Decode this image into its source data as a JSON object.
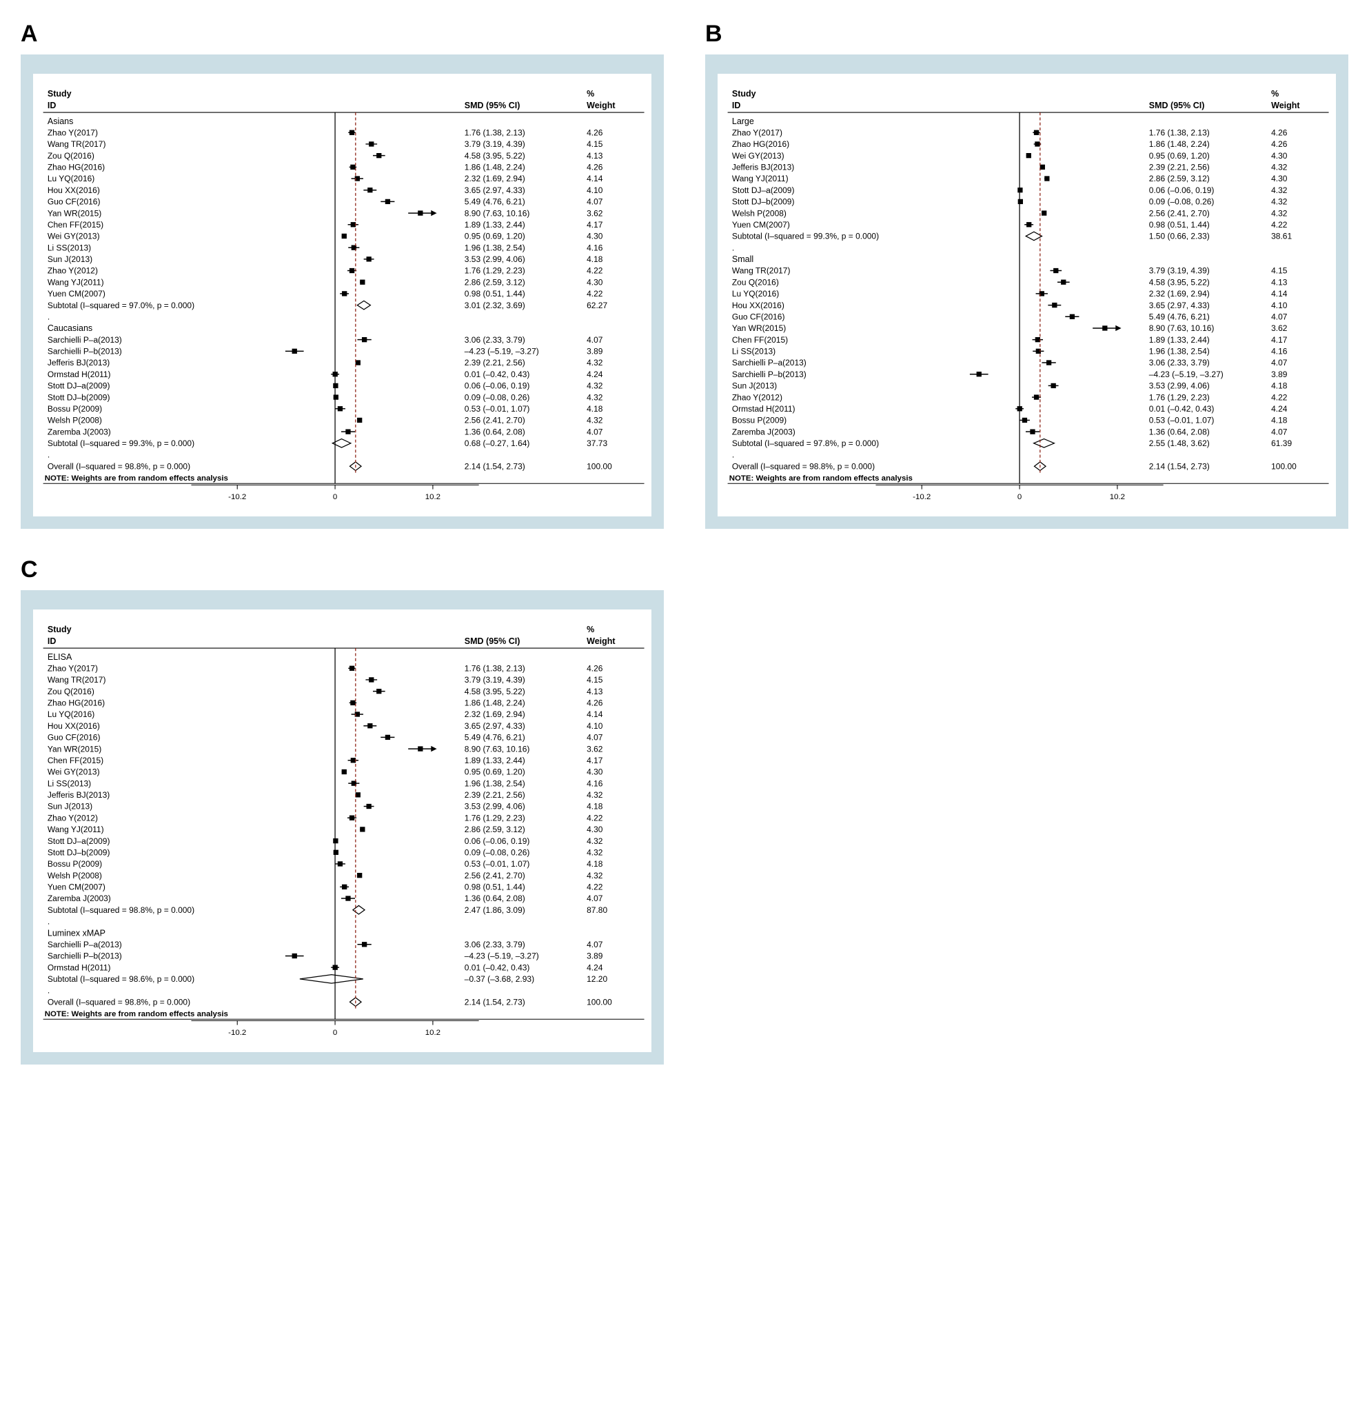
{
  "chart_data": [
    {
      "id": "A",
      "type": "forestplot",
      "title": "",
      "headers": {
        "study": "Study",
        "id": "ID",
        "smd": "SMD (95% CI)",
        "pct": "%",
        "weight": "Weight"
      },
      "xlim": [
        -12,
        12
      ],
      "xticks": [
        -10.2,
        0,
        10.2
      ],
      "overall_line": 2.14,
      "groups": [
        {
          "name": "Asians",
          "rows": [
            {
              "label": "Zhao Y(2017)",
              "pt": 1.76,
              "lo": 1.38,
              "hi": 2.13,
              "smd": "1.76 (1.38, 2.13)",
              "weight": "4.26"
            },
            {
              "label": "Wang TR(2017)",
              "pt": 3.79,
              "lo": 3.19,
              "hi": 4.39,
              "smd": "3.79 (3.19, 4.39)",
              "weight": "4.15"
            },
            {
              "label": "Zou Q(2016)",
              "pt": 4.58,
              "lo": 3.95,
              "hi": 5.22,
              "smd": "4.58 (3.95, 5.22)",
              "weight": "4.13"
            },
            {
              "label": "Zhao HG(2016)",
              "pt": 1.86,
              "lo": 1.48,
              "hi": 2.24,
              "smd": "1.86 (1.48, 2.24)",
              "weight": "4.26"
            },
            {
              "label": "Lu YQ(2016)",
              "pt": 2.32,
              "lo": 1.69,
              "hi": 2.94,
              "smd": "2.32 (1.69, 2.94)",
              "weight": "4.14"
            },
            {
              "label": "Hou XX(2016)",
              "pt": 3.65,
              "lo": 2.97,
              "hi": 4.33,
              "smd": "3.65 (2.97, 4.33)",
              "weight": "4.10"
            },
            {
              "label": "Guo CF(2016)",
              "pt": 5.49,
              "lo": 4.76,
              "hi": 6.21,
              "smd": "5.49 (4.76, 6.21)",
              "weight": "4.07"
            },
            {
              "label": "Yan WR(2015)",
              "pt": 8.9,
              "lo": 7.63,
              "hi": 10.16,
              "smd": "8.90 (7.63, 10.16)",
              "weight": "3.62",
              "arrow": true
            },
            {
              "label": "Chen FF(2015)",
              "pt": 1.89,
              "lo": 1.33,
              "hi": 2.44,
              "smd": "1.89 (1.33, 2.44)",
              "weight": "4.17"
            },
            {
              "label": "Wei GY(2013)",
              "pt": 0.95,
              "lo": 0.69,
              "hi": 1.2,
              "smd": "0.95 (0.69, 1.20)",
              "weight": "4.30"
            },
            {
              "label": "Li SS(2013)",
              "pt": 1.96,
              "lo": 1.38,
              "hi": 2.54,
              "smd": "1.96 (1.38, 2.54)",
              "weight": "4.16"
            },
            {
              "label": "Sun J(2013)",
              "pt": 3.53,
              "lo": 2.99,
              "hi": 4.06,
              "smd": "3.53 (2.99, 4.06)",
              "weight": "4.18"
            },
            {
              "label": "Zhao Y(2012)",
              "pt": 1.76,
              "lo": 1.29,
              "hi": 2.23,
              "smd": "1.76 (1.29, 2.23)",
              "weight": "4.22"
            },
            {
              "label": "Wang YJ(2011)",
              "pt": 2.86,
              "lo": 2.59,
              "hi": 3.12,
              "smd": "2.86 (2.59, 3.12)",
              "weight": "4.30"
            },
            {
              "label": "Yuen CM(2007)",
              "pt": 0.98,
              "lo": 0.51,
              "hi": 1.44,
              "smd": "0.98 (0.51, 1.44)",
              "weight": "4.22"
            }
          ],
          "subtotal": {
            "label": "Subtotal  (I–squared = 97.0%, p = 0.000)",
            "pt": 3.01,
            "lo": 2.32,
            "hi": 3.69,
            "smd": "3.01 (2.32, 3.69)",
            "weight": "62.27"
          }
        },
        {
          "name": "Caucasians",
          "rows": [
            {
              "label": "Sarchielli P–a(2013)",
              "pt": 3.06,
              "lo": 2.33,
              "hi": 3.79,
              "smd": "3.06 (2.33, 3.79)",
              "weight": "4.07"
            },
            {
              "label": "Sarchielli P–b(2013)",
              "pt": -4.23,
              "lo": -5.19,
              "hi": -3.27,
              "smd": "–4.23 (–5.19, –3.27)",
              "weight": "3.89"
            },
            {
              "label": "Jefferis BJ(2013)",
              "pt": 2.39,
              "lo": 2.21,
              "hi": 2.56,
              "smd": "2.39 (2.21, 2.56)",
              "weight": "4.32"
            },
            {
              "label": "Ormstad H(2011)",
              "pt": 0.01,
              "lo": -0.42,
              "hi": 0.43,
              "smd": "0.01 (–0.42, 0.43)",
              "weight": "4.24"
            },
            {
              "label": "Stott DJ–a(2009)",
              "pt": 0.06,
              "lo": -0.06,
              "hi": 0.19,
              "smd": "0.06 (–0.06, 0.19)",
              "weight": "4.32"
            },
            {
              "label": "Stott DJ–b(2009)",
              "pt": 0.09,
              "lo": -0.08,
              "hi": 0.26,
              "smd": "0.09 (–0.08, 0.26)",
              "weight": "4.32"
            },
            {
              "label": "Bossu P(2009)",
              "pt": 0.53,
              "lo": -0.01,
              "hi": 1.07,
              "smd": "0.53 (–0.01, 1.07)",
              "weight": "4.18"
            },
            {
              "label": "Welsh P(2008)",
              "pt": 2.56,
              "lo": 2.41,
              "hi": 2.7,
              "smd": "2.56 (2.41, 2.70)",
              "weight": "4.32"
            },
            {
              "label": "Zaremba J(2003)",
              "pt": 1.36,
              "lo": 0.64,
              "hi": 2.08,
              "smd": "1.36 (0.64, 2.08)",
              "weight": "4.07"
            }
          ],
          "subtotal": {
            "label": "Subtotal  (I–squared = 99.3%, p = 0.000)",
            "pt": 0.68,
            "lo": -0.27,
            "hi": 1.64,
            "smd": "0.68 (–0.27, 1.64)",
            "weight": "37.73"
          }
        }
      ],
      "overall": {
        "label": "Overall  (I–squared = 98.8%, p = 0.000)",
        "pt": 2.14,
        "lo": 1.54,
        "hi": 2.73,
        "smd": "2.14 (1.54, 2.73)",
        "weight": "100.00"
      },
      "note": "NOTE: Weights are from random effects analysis"
    },
    {
      "id": "B",
      "type": "forestplot",
      "headers": {
        "study": "Study",
        "id": "ID",
        "smd": "SMD (95% CI)",
        "pct": "%",
        "weight": "Weight"
      },
      "xlim": [
        -12,
        12
      ],
      "xticks": [
        -10.2,
        0,
        10.2
      ],
      "overall_line": 2.14,
      "groups": [
        {
          "name": "Large",
          "rows": [
            {
              "label": "Zhao Y(2017)",
              "pt": 1.76,
              "lo": 1.38,
              "hi": 2.13,
              "smd": "1.76 (1.38, 2.13)",
              "weight": "4.26"
            },
            {
              "label": "Zhao HG(2016)",
              "pt": 1.86,
              "lo": 1.48,
              "hi": 2.24,
              "smd": "1.86 (1.48, 2.24)",
              "weight": "4.26"
            },
            {
              "label": "Wei GY(2013)",
              "pt": 0.95,
              "lo": 0.69,
              "hi": 1.2,
              "smd": "0.95 (0.69, 1.20)",
              "weight": "4.30"
            },
            {
              "label": "Jefferis BJ(2013)",
              "pt": 2.39,
              "lo": 2.21,
              "hi": 2.56,
              "smd": "2.39 (2.21, 2.56)",
              "weight": "4.32"
            },
            {
              "label": "Wang YJ(2011)",
              "pt": 2.86,
              "lo": 2.59,
              "hi": 3.12,
              "smd": "2.86 (2.59, 3.12)",
              "weight": "4.30"
            },
            {
              "label": "Stott DJ–a(2009)",
              "pt": 0.06,
              "lo": -0.06,
              "hi": 0.19,
              "smd": "0.06 (–0.06, 0.19)",
              "weight": "4.32"
            },
            {
              "label": "Stott DJ–b(2009)",
              "pt": 0.09,
              "lo": -0.08,
              "hi": 0.26,
              "smd": "0.09 (–0.08, 0.26)",
              "weight": "4.32"
            },
            {
              "label": "Welsh P(2008)",
              "pt": 2.56,
              "lo": 2.41,
              "hi": 2.7,
              "smd": "2.56 (2.41, 2.70)",
              "weight": "4.32"
            },
            {
              "label": "Yuen CM(2007)",
              "pt": 0.98,
              "lo": 0.51,
              "hi": 1.44,
              "smd": "0.98 (0.51, 1.44)",
              "weight": "4.22"
            }
          ],
          "subtotal": {
            "label": "Subtotal  (I–squared = 99.3%, p = 0.000)",
            "pt": 1.5,
            "lo": 0.66,
            "hi": 2.33,
            "smd": "1.50 (0.66, 2.33)",
            "weight": "38.61"
          }
        },
        {
          "name": "Small",
          "rows": [
            {
              "label": "Wang TR(2017)",
              "pt": 3.79,
              "lo": 3.19,
              "hi": 4.39,
              "smd": "3.79 (3.19, 4.39)",
              "weight": "4.15"
            },
            {
              "label": "Zou Q(2016)",
              "pt": 4.58,
              "lo": 3.95,
              "hi": 5.22,
              "smd": "4.58 (3.95, 5.22)",
              "weight": "4.13"
            },
            {
              "label": "Lu YQ(2016)",
              "pt": 2.32,
              "lo": 1.69,
              "hi": 2.94,
              "smd": "2.32 (1.69, 2.94)",
              "weight": "4.14"
            },
            {
              "label": "Hou XX(2016)",
              "pt": 3.65,
              "lo": 2.97,
              "hi": 4.33,
              "smd": "3.65 (2.97, 4.33)",
              "weight": "4.10"
            },
            {
              "label": "Guo CF(2016)",
              "pt": 5.49,
              "lo": 4.76,
              "hi": 6.21,
              "smd": "5.49 (4.76, 6.21)",
              "weight": "4.07"
            },
            {
              "label": "Yan WR(2015)",
              "pt": 8.9,
              "lo": 7.63,
              "hi": 10.16,
              "smd": "8.90 (7.63, 10.16)",
              "weight": "3.62",
              "arrow": true
            },
            {
              "label": "Chen FF(2015)",
              "pt": 1.89,
              "lo": 1.33,
              "hi": 2.44,
              "smd": "1.89 (1.33, 2.44)",
              "weight": "4.17"
            },
            {
              "label": "Li SS(2013)",
              "pt": 1.96,
              "lo": 1.38,
              "hi": 2.54,
              "smd": "1.96 (1.38, 2.54)",
              "weight": "4.16"
            },
            {
              "label": "Sarchielli P–a(2013)",
              "pt": 3.06,
              "lo": 2.33,
              "hi": 3.79,
              "smd": "3.06 (2.33, 3.79)",
              "weight": "4.07"
            },
            {
              "label": "Sarchielli P–b(2013)",
              "pt": -4.23,
              "lo": -5.19,
              "hi": -3.27,
              "smd": "–4.23 (–5.19, –3.27)",
              "weight": "3.89"
            },
            {
              "label": "Sun J(2013)",
              "pt": 3.53,
              "lo": 2.99,
              "hi": 4.06,
              "smd": "3.53 (2.99, 4.06)",
              "weight": "4.18"
            },
            {
              "label": "Zhao Y(2012)",
              "pt": 1.76,
              "lo": 1.29,
              "hi": 2.23,
              "smd": "1.76 (1.29, 2.23)",
              "weight": "4.22"
            },
            {
              "label": "Ormstad H(2011)",
              "pt": 0.01,
              "lo": -0.42,
              "hi": 0.43,
              "smd": "0.01 (–0.42, 0.43)",
              "weight": "4.24"
            },
            {
              "label": "Bossu P(2009)",
              "pt": 0.53,
              "lo": -0.01,
              "hi": 1.07,
              "smd": "0.53 (–0.01, 1.07)",
              "weight": "4.18"
            },
            {
              "label": "Zaremba J(2003)",
              "pt": 1.36,
              "lo": 0.64,
              "hi": 2.08,
              "smd": "1.36 (0.64, 2.08)",
              "weight": "4.07"
            }
          ],
          "subtotal": {
            "label": "Subtotal  (I–squared = 97.8%, p = 0.000)",
            "pt": 2.55,
            "lo": 1.48,
            "hi": 3.62,
            "smd": "2.55 (1.48, 3.62)",
            "weight": "61.39"
          }
        }
      ],
      "overall": {
        "label": "Overall  (I–squared = 98.8%, p = 0.000)",
        "pt": 2.14,
        "lo": 1.54,
        "hi": 2.73,
        "smd": "2.14 (1.54, 2.73)",
        "weight": "100.00"
      },
      "note": "NOTE: Weights are from random effects analysis"
    },
    {
      "id": "C",
      "type": "forestplot",
      "headers": {
        "study": "Study",
        "id": "ID",
        "smd": "SMD (95% CI)",
        "pct": "%",
        "weight": "Weight"
      },
      "xlim": [
        -12,
        12
      ],
      "xticks": [
        -10.2,
        0,
        10.2
      ],
      "overall_line": 2.14,
      "groups": [
        {
          "name": "ELISA",
          "rows": [
            {
              "label": "Zhao Y(2017)",
              "pt": 1.76,
              "lo": 1.38,
              "hi": 2.13,
              "smd": "1.76 (1.38, 2.13)",
              "weight": "4.26"
            },
            {
              "label": "Wang TR(2017)",
              "pt": 3.79,
              "lo": 3.19,
              "hi": 4.39,
              "smd": "3.79 (3.19, 4.39)",
              "weight": "4.15"
            },
            {
              "label": "Zou Q(2016)",
              "pt": 4.58,
              "lo": 3.95,
              "hi": 5.22,
              "smd": "4.58 (3.95, 5.22)",
              "weight": "4.13"
            },
            {
              "label": "Zhao HG(2016)",
              "pt": 1.86,
              "lo": 1.48,
              "hi": 2.24,
              "smd": "1.86 (1.48, 2.24)",
              "weight": "4.26"
            },
            {
              "label": "Lu YQ(2016)",
              "pt": 2.32,
              "lo": 1.69,
              "hi": 2.94,
              "smd": "2.32 (1.69, 2.94)",
              "weight": "4.14"
            },
            {
              "label": "Hou XX(2016)",
              "pt": 3.65,
              "lo": 2.97,
              "hi": 4.33,
              "smd": "3.65 (2.97, 4.33)",
              "weight": "4.10"
            },
            {
              "label": "Guo CF(2016)",
              "pt": 5.49,
              "lo": 4.76,
              "hi": 6.21,
              "smd": "5.49 (4.76, 6.21)",
              "weight": "4.07"
            },
            {
              "label": "Yan WR(2015)",
              "pt": 8.9,
              "lo": 7.63,
              "hi": 10.16,
              "smd": "8.90 (7.63, 10.16)",
              "weight": "3.62",
              "arrow": true
            },
            {
              "label": "Chen FF(2015)",
              "pt": 1.89,
              "lo": 1.33,
              "hi": 2.44,
              "smd": "1.89 (1.33, 2.44)",
              "weight": "4.17"
            },
            {
              "label": "Wei GY(2013)",
              "pt": 0.95,
              "lo": 0.69,
              "hi": 1.2,
              "smd": "0.95 (0.69, 1.20)",
              "weight": "4.30"
            },
            {
              "label": "Li SS(2013)",
              "pt": 1.96,
              "lo": 1.38,
              "hi": 2.54,
              "smd": "1.96 (1.38, 2.54)",
              "weight": "4.16"
            },
            {
              "label": "Jefferis BJ(2013)",
              "pt": 2.39,
              "lo": 2.21,
              "hi": 2.56,
              "smd": "2.39 (2.21, 2.56)",
              "weight": "4.32"
            },
            {
              "label": "Sun J(2013)",
              "pt": 3.53,
              "lo": 2.99,
              "hi": 4.06,
              "smd": "3.53 (2.99, 4.06)",
              "weight": "4.18"
            },
            {
              "label": "Zhao Y(2012)",
              "pt": 1.76,
              "lo": 1.29,
              "hi": 2.23,
              "smd": "1.76 (1.29, 2.23)",
              "weight": "4.22"
            },
            {
              "label": "Wang YJ(2011)",
              "pt": 2.86,
              "lo": 2.59,
              "hi": 3.12,
              "smd": "2.86 (2.59, 3.12)",
              "weight": "4.30"
            },
            {
              "label": "Stott DJ–a(2009)",
              "pt": 0.06,
              "lo": -0.06,
              "hi": 0.19,
              "smd": "0.06 (–0.06, 0.19)",
              "weight": "4.32"
            },
            {
              "label": "Stott DJ–b(2009)",
              "pt": 0.09,
              "lo": -0.08,
              "hi": 0.26,
              "smd": "0.09 (–0.08, 0.26)",
              "weight": "4.32"
            },
            {
              "label": "Bossu P(2009)",
              "pt": 0.53,
              "lo": -0.01,
              "hi": 1.07,
              "smd": "0.53 (–0.01, 1.07)",
              "weight": "4.18"
            },
            {
              "label": "Welsh P(2008)",
              "pt": 2.56,
              "lo": 2.41,
              "hi": 2.7,
              "smd": "2.56 (2.41, 2.70)",
              "weight": "4.32"
            },
            {
              "label": "Yuen CM(2007)",
              "pt": 0.98,
              "lo": 0.51,
              "hi": 1.44,
              "smd": "0.98 (0.51, 1.44)",
              "weight": "4.22"
            },
            {
              "label": "Zaremba J(2003)",
              "pt": 1.36,
              "lo": 0.64,
              "hi": 2.08,
              "smd": "1.36 (0.64, 2.08)",
              "weight": "4.07"
            }
          ],
          "subtotal": {
            "label": "Subtotal  (I–squared = 98.8%, p = 0.000)",
            "pt": 2.47,
            "lo": 1.86,
            "hi": 3.09,
            "smd": "2.47 (1.86, 3.09)",
            "weight": "87.80"
          }
        },
        {
          "name": "Luminex xMAP",
          "rows": [
            {
              "label": "Sarchielli P–a(2013)",
              "pt": 3.06,
              "lo": 2.33,
              "hi": 3.79,
              "smd": "3.06 (2.33, 3.79)",
              "weight": "4.07"
            },
            {
              "label": "Sarchielli P–b(2013)",
              "pt": -4.23,
              "lo": -5.19,
              "hi": -3.27,
              "smd": "–4.23 (–5.19, –3.27)",
              "weight": "3.89"
            },
            {
              "label": "Ormstad H(2011)",
              "pt": 0.01,
              "lo": -0.42,
              "hi": 0.43,
              "smd": "0.01 (–0.42, 0.43)",
              "weight": "4.24"
            }
          ],
          "subtotal": {
            "label": "Subtotal  (I–squared = 98.6%, p = 0.000)",
            "pt": -0.37,
            "lo": -3.68,
            "hi": 2.93,
            "smd": "–0.37 (–3.68, 2.93)",
            "weight": "12.20"
          }
        }
      ],
      "overall": {
        "label": "Overall  (I–squared = 98.8%, p = 0.000)",
        "pt": 2.14,
        "lo": 1.54,
        "hi": 2.73,
        "smd": "2.14 (1.54, 2.73)",
        "weight": "100.00"
      },
      "note": "NOTE: Weights are from random effects analysis"
    }
  ]
}
